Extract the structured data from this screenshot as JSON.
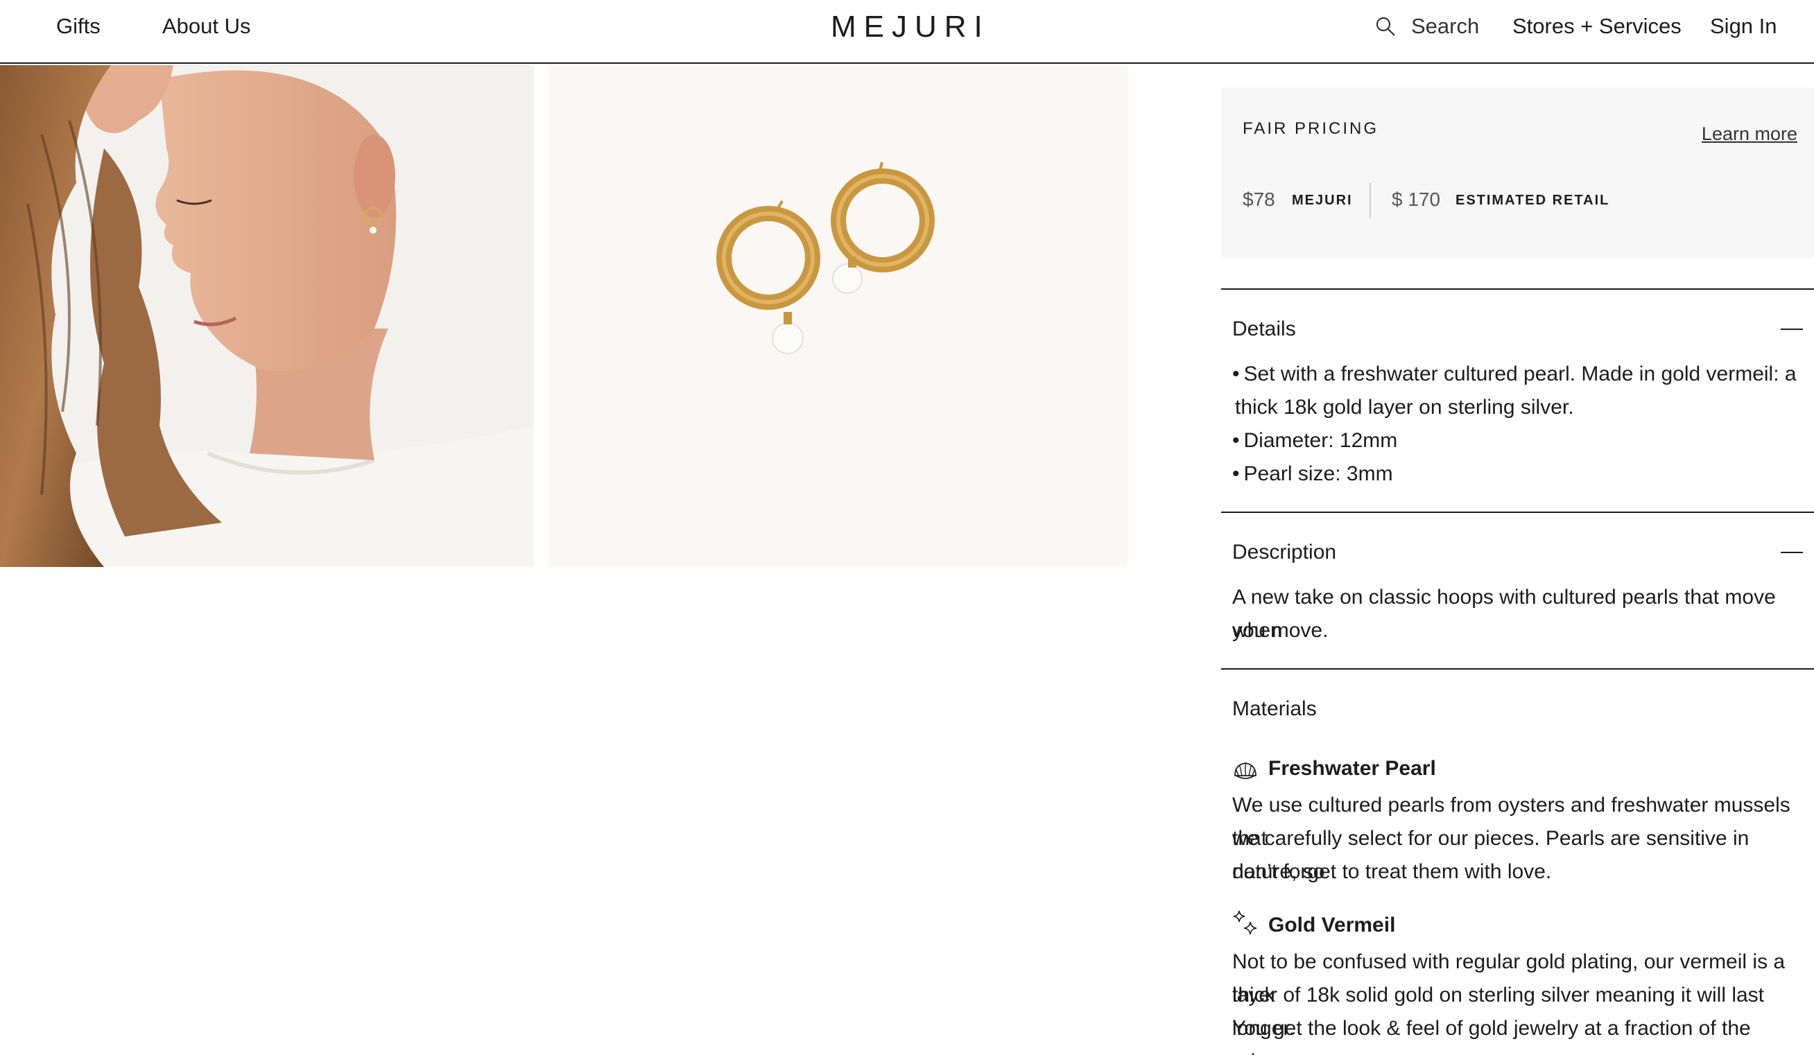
{
  "header": {
    "nav_left": [
      "Gifts",
      "About Us"
    ],
    "logo": "MEJURI",
    "search_label": "Search",
    "stores_label": "Stores + Services",
    "sign_in_label": "Sign In"
  },
  "pricing": {
    "title": "FAIR PRICING",
    "learn_more": "Learn more",
    "mejuri_price": "$78",
    "mejuri_label": "MEJURI",
    "retail_price": "$ 170",
    "retail_label": "ESTIMATED RETAIL"
  },
  "details": {
    "title": "Details",
    "bullets": [
      "Set with a freshwater cultured pearl. Made in gold vermeil: a",
      "thick 18k gold layer on sterling silver.",
      "Diameter: 12mm",
      "Pearl size: 3mm"
    ]
  },
  "description": {
    "title": "Description",
    "lines": [
      "A new take on classic hoops with cultured pearls that move when",
      "you move."
    ]
  },
  "materials": {
    "title": "Materials",
    "items": [
      {
        "name": "Freshwater Pearl",
        "icon": "shell-icon",
        "lines": [
          "We use cultured pearls from oysters and freshwater mussels that",
          "we carefully select for our pieces. Pearls are sensitive in nature, so",
          "don’t forget to treat them with love."
        ]
      },
      {
        "name": "Gold Vermeil",
        "icon": "sparkle-icon",
        "lines": [
          "Not to be confused with regular gold plating, our vermeil is a thick",
          "layer of 18k solid gold on sterling silver meaning it will last longer.",
          "You get the look & feel of gold jewelry at a fraction of the price."
        ]
      }
    ]
  }
}
